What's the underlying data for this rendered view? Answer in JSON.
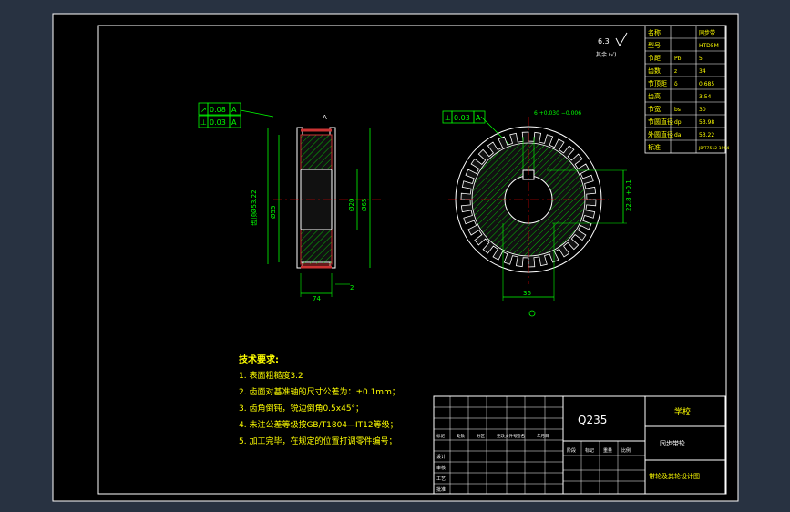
{
  "colors": {
    "workspace": "#283241",
    "sheet": "#000000",
    "sheet_border": "#ffffff",
    "geometry": "#ffffff",
    "dimension": "#00ff00",
    "centerline": "#ff0000",
    "section_body": "#cc3333",
    "hatch": "#00ff00",
    "table_text": "#ffff00",
    "tech_text": "#ffff00",
    "title_text": "#ffffff"
  },
  "roughness": {
    "symbol": "6.3",
    "note": "其余  (√)"
  },
  "param_table": {
    "rows": [
      [
        "名称",
        "",
        "同步带"
      ],
      [
        "型号",
        "",
        "HTD5M"
      ],
      [
        "节距",
        "Pb",
        "5"
      ],
      [
        "齿数",
        "z",
        "34"
      ],
      [
        "节顶距",
        "δ",
        "0.685"
      ],
      [
        "齿高",
        "",
        "3.54"
      ],
      [
        "节宽",
        "bs",
        "30"
      ],
      [
        "节圆直径",
        "dp",
        "53.98"
      ],
      [
        "外圆直径",
        "da",
        "53.22"
      ],
      [
        "标准",
        "",
        "JB/T7512-1994"
      ]
    ]
  },
  "side_view": {
    "tolerance_frames": [
      [
        "↗",
        "0.08",
        "A"
      ],
      [
        "⊥",
        "0.03",
        "A"
      ]
    ],
    "dims": {
      "left_outer": "齿顶Ø53.22",
      "left_inner": "Ø55",
      "bore": "Ø20",
      "right_outer": "Ø65",
      "width": "74",
      "flange": "2"
    },
    "datum_label": "A"
  },
  "front_view": {
    "tolerance_frame": [
      "⊥",
      "0.03",
      "A"
    ],
    "keyway_width": "6 +0.030 −0.006",
    "keyway_depth": "22.8 +0.1",
    "bore_label": "36"
  },
  "tech_requirements": {
    "title": "技术要求:",
    "items": [
      "1. 表面粗糙度3.2",
      "2. 齿面对基准轴的尺寸公差为：±0.1mm；",
      "3. 齿角倒钝，锐边倒角0.5x45°；",
      "4. 未注公差等级按GB/T1804—IT12等级；",
      "5. 加工完毕，在规定的位置打调零件编号；"
    ]
  },
  "title_block": {
    "material": "Q235",
    "school": "学校",
    "part_name": "同步带轮",
    "drawing_name": "带轮及其轮设计图",
    "small_labels": [
      "标记",
      "处数",
      "分区",
      "更改文件号",
      "签名",
      "年月日"
    ],
    "stage_labels": [
      "阶段",
      "标记",
      "重量",
      "比例"
    ],
    "role_labels": [
      "设计",
      "审核",
      "工艺",
      "批准"
    ]
  }
}
